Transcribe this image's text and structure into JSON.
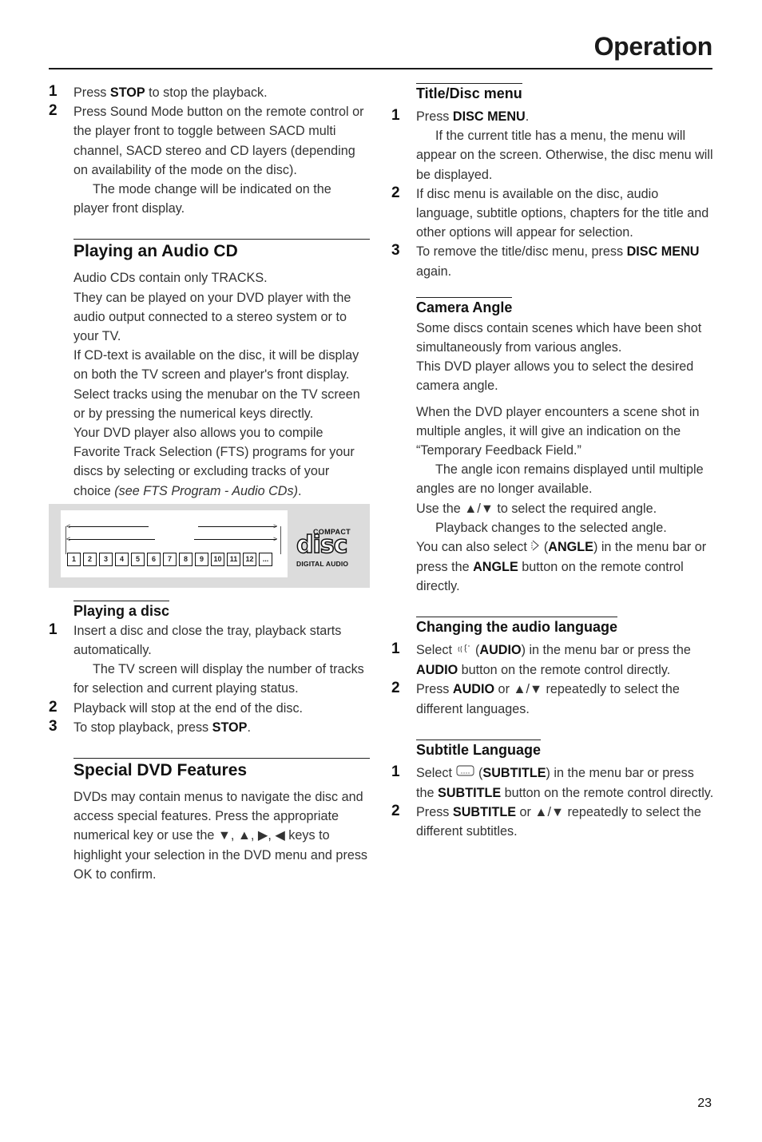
{
  "header": {
    "title": "Operation"
  },
  "left_column": {
    "intro_steps": [
      {
        "num": "1",
        "pre": "Press ",
        "bold": "STOP",
        "post": " to stop the playback."
      },
      {
        "num": "2",
        "text": "Press Sound Mode button on the remote control or the player front to toggle between SACD multi channel, SACD stereo and CD layers (depending on availability of the mode on the disc).",
        "note": "The mode change will be indicated on the player front display."
      }
    ],
    "audio_cd": {
      "heading": "Playing an Audio CD",
      "para1": "Audio CDs contain only TRACKS.",
      "para2": "They can be played on your DVD player with the audio output connected to a stereo system or to your TV.",
      "para3": "If CD-text is available on the disc, it will be display on both the TV screen and player's front display.",
      "para4": "Select tracks using the menubar on the TV screen or by pressing the numerical keys directly.",
      "para5_pre": "Your DVD player also allows you to compile Favorite Track Selection (FTS) programs for your discs by selecting or excluding tracks of your choice ",
      "para5_italic": "(see FTS Program - Audio CDs)",
      "para5_post": "."
    },
    "figure": {
      "tracks": [
        "1",
        "2",
        "3",
        "4",
        "5",
        "6",
        "7",
        "8",
        "9",
        "10",
        "11",
        "12",
        "..."
      ],
      "logo_top": "COMPACT",
      "logo_main": "disc",
      "logo_bottom": "DIGITAL AUDIO"
    },
    "playing_disc": {
      "heading": "Playing a disc",
      "step1": "Insert a disc and close the tray, playback starts automatically.",
      "step1_note": "The TV screen will display the number of tracks for selection and current playing status.",
      "step2": "Playback will stop at the end of the disc.",
      "step3_pre": "To stop playback, press ",
      "step3_bold": "STOP",
      "step3_post": ".",
      "nums": [
        "1",
        "2",
        "3"
      ]
    },
    "special_dvd": {
      "heading": "Special DVD Features",
      "para_pre": "DVDs may contain menus to navigate the disc and access special features. Press the appropriate numerical key or use the ",
      "keys": "▼, ▲, ▶, ◀",
      "para_post": " keys to highlight your selection in the DVD menu and press OK to confirm."
    }
  },
  "right_column": {
    "title_disc_menu": {
      "heading": "Title/Disc menu",
      "nums": [
        "1",
        "2",
        "3"
      ],
      "step1_pre": "Press ",
      "step1_bold": "DISC MENU",
      "step1_post": ".",
      "step1_note": "If the current title has a menu, the menu will appear on the screen. Otherwise, the disc menu will be displayed.",
      "step2": "If disc menu is available on the disc, audio language, subtitle options, chapters for the title and other options will appear for selection.",
      "step3_pre": "To remove the title/disc menu, press ",
      "step3_bold": "DISC MENU",
      "step3_post": " again."
    },
    "camera_angle": {
      "heading": "Camera Angle",
      "para1": "Some discs contain scenes which have been shot simultaneously from various angles.",
      "para2": "This DVD player allows you to select the desired camera angle.",
      "para3": "When the DVD player encounters a scene shot in multiple angles, it will give an indication on the “Temporary Feedback Field.”",
      "note1": "The angle icon remains displayed until multiple angles are no longer available.",
      "para4_pre": "Use the ",
      "para4_keys": "▲/▼",
      "para4_post": " to select the required angle.",
      "note2": "Playback changes to the selected angle.",
      "para5_pre": "You can also select ",
      "para5_open": " (",
      "para5_bold1": "ANGLE",
      "para5_mid": ") in the menu bar or press the ",
      "para5_bold2": "ANGLE",
      "para5_post": " button on the remote control directly."
    },
    "audio_language": {
      "heading": "Changing the audio language",
      "nums": [
        "1",
        "2"
      ],
      "step1_pre": "Select ",
      "step1_open": " (",
      "step1_bold1": "AUDIO",
      "step1_mid": ") in the menu bar or press the ",
      "step1_bold2": "AUDIO",
      "step1_post": " button on the remote control directly.",
      "step2_pre": "Press ",
      "step2_bold": "AUDIO",
      "step2_mid": " or ",
      "step2_keys": "▲/▼",
      "step2_post": " repeatedly to select the different languages."
    },
    "subtitle_language": {
      "heading": "Subtitle Language",
      "nums": [
        "1",
        "2"
      ],
      "step1_pre": "Select ",
      "step1_open": " (",
      "step1_bold1": "SUBTITLE",
      "step1_mid": ") in the menu bar or press the ",
      "step1_bold2": "SUBTITLE",
      "step1_post": " button on the remote control directly.",
      "step2_pre": "Press ",
      "step2_bold": "SUBTITLE",
      "step2_mid": " or ",
      "step2_keys": "▲/▼",
      "step2_post": " repeatedly to select the different subtitles."
    }
  },
  "footer": {
    "page_number": "23"
  }
}
